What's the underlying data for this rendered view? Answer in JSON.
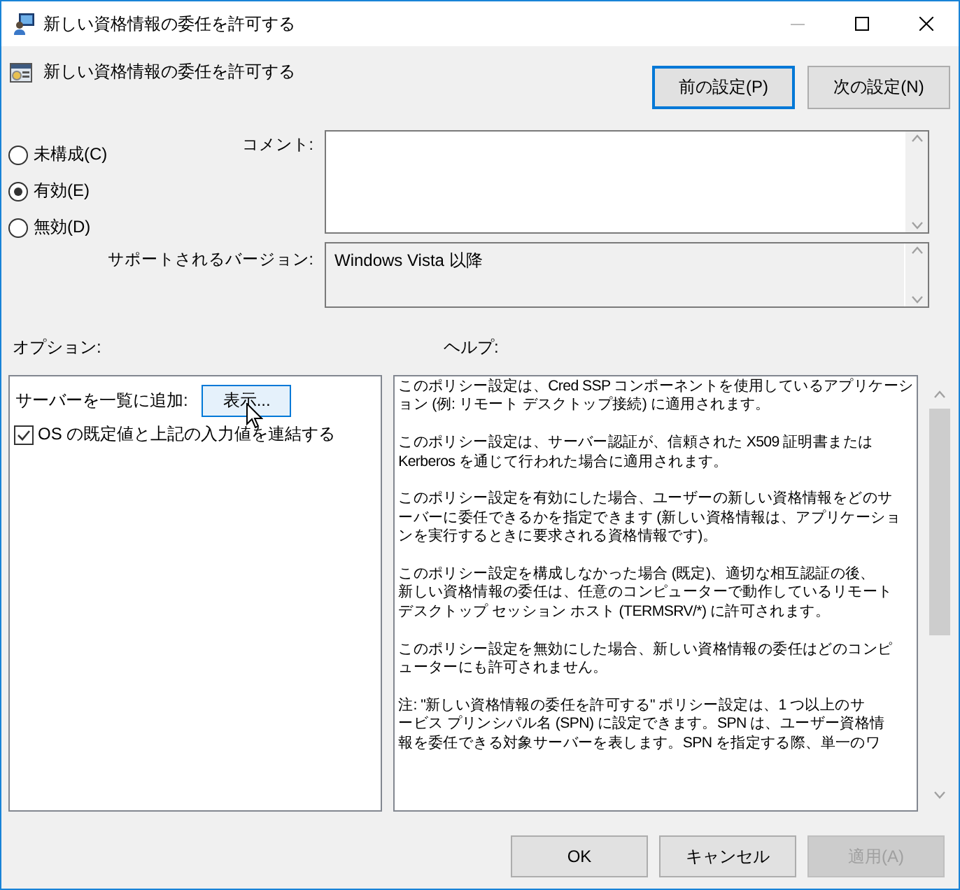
{
  "window": {
    "title": "新しい資格情報の委任を許可する"
  },
  "policy_title": "新しい資格情報の委任を許可する",
  "nav_buttons": [
    {
      "label": "前の設定(P)",
      "focused": true
    },
    {
      "label": "次の設定(N)",
      "focused": false
    }
  ],
  "state_options": [
    {
      "label": "未構成(C)",
      "selected": false
    },
    {
      "label": "有効(E)",
      "selected": true
    },
    {
      "label": "無効(D)",
      "selected": false
    }
  ],
  "comment": {
    "label": "コメント:"
  },
  "supported": {
    "label": "サポートされるバージョン:",
    "value": "Windows Vista 以降"
  },
  "options": {
    "heading": "オプション:",
    "server_list": {
      "label": "サーバーを一覧に追加:",
      "button": "表示...",
      "hovered": true
    },
    "concatenate": {
      "label": "OS の既定値と上記の入力値を連結する",
      "checked": true
    }
  },
  "help": {
    "heading": "ヘルプ:",
    "paragraphs": [
      [
        "このポリシー設定は、Cred SSP コンポーネントを使用しているアプリケーシ",
        "ョン (例: リモート デスクトップ接続) に適用されます。"
      ],
      [
        "このポリシー設定は、サーバー認証が、信頼された X509 証明書または",
        "Kerberos を通じて行われた場合に適用されます。"
      ],
      [
        "このポリシー設定を有効にした場合、ユーザーの新しい資格情報をどのサ",
        "ーバーに委任できるかを指定できます (新しい資格情報は、アプリケーショ",
        "ンを実行するときに要求される資格情報です)。"
      ],
      [
        "このポリシー設定を構成しなかった場合 (既定)、適切な相互認証の後、",
        "新しい資格情報の委任は、任意のコンピューターで動作しているリモート",
        "デスクトップ セッション ホスト (TERMSRV/*) に許可されます。"
      ],
      [
        "このポリシー設定を無効にした場合、新しい資格情報の委任はどのコンピ",
        "ューターにも許可されません。"
      ],
      [
        "注: \"新しい資格情報の委任を許可する\" ポリシー設定は、1 つ以上のサ",
        "ービス プリンシパル名 (SPN) に設定できます。SPN は、ユーザー資格情",
        "報を委任できる対象サーバーを表します。SPN を指定する際、単一のワ"
      ]
    ]
  },
  "footer_buttons": [
    {
      "label": "OK",
      "disabled": false
    },
    {
      "label": "キャンセル",
      "disabled": false
    },
    {
      "label": "適用(A)",
      "disabled": true
    }
  ]
}
